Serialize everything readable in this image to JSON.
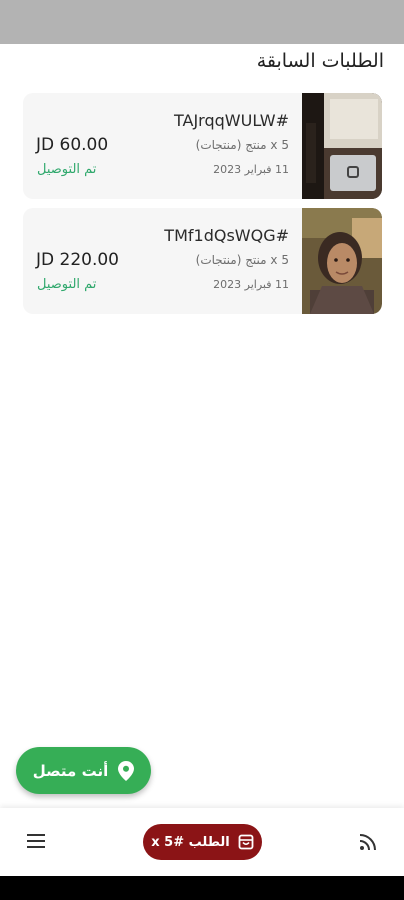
{
  "title": "الطلبات السابقة",
  "orders": [
    {
      "id": "TAJrqqWULW#",
      "items": "5 x منتج (منتجات)",
      "date": "11 فبراير 2023",
      "price": "JD 60.00",
      "status": "تم التوصيل",
      "thumb_icon": "laptop-photo"
    },
    {
      "id": "TMf1dQsWQG#",
      "items": "5 x منتج (منتجات)",
      "date": "11 فبراير 2023",
      "price": "JD 220.00",
      "status": "تم التوصيل",
      "thumb_icon": "person-photo"
    }
  ],
  "online_button": {
    "label": "أنت متصل",
    "icon": "location-pin-icon"
  },
  "bottom_bar": {
    "cart_label": "الطلب #x 5",
    "cart_icon": "shopping-bag-icon",
    "menu_icon": "hamburger-menu-icon",
    "rss_icon": "rss-icon"
  },
  "colors": {
    "status_green": "#2fa86c",
    "fab_green": "#36ae56",
    "cart_red": "#8b1416",
    "card_bg": "#f6f6f6"
  }
}
